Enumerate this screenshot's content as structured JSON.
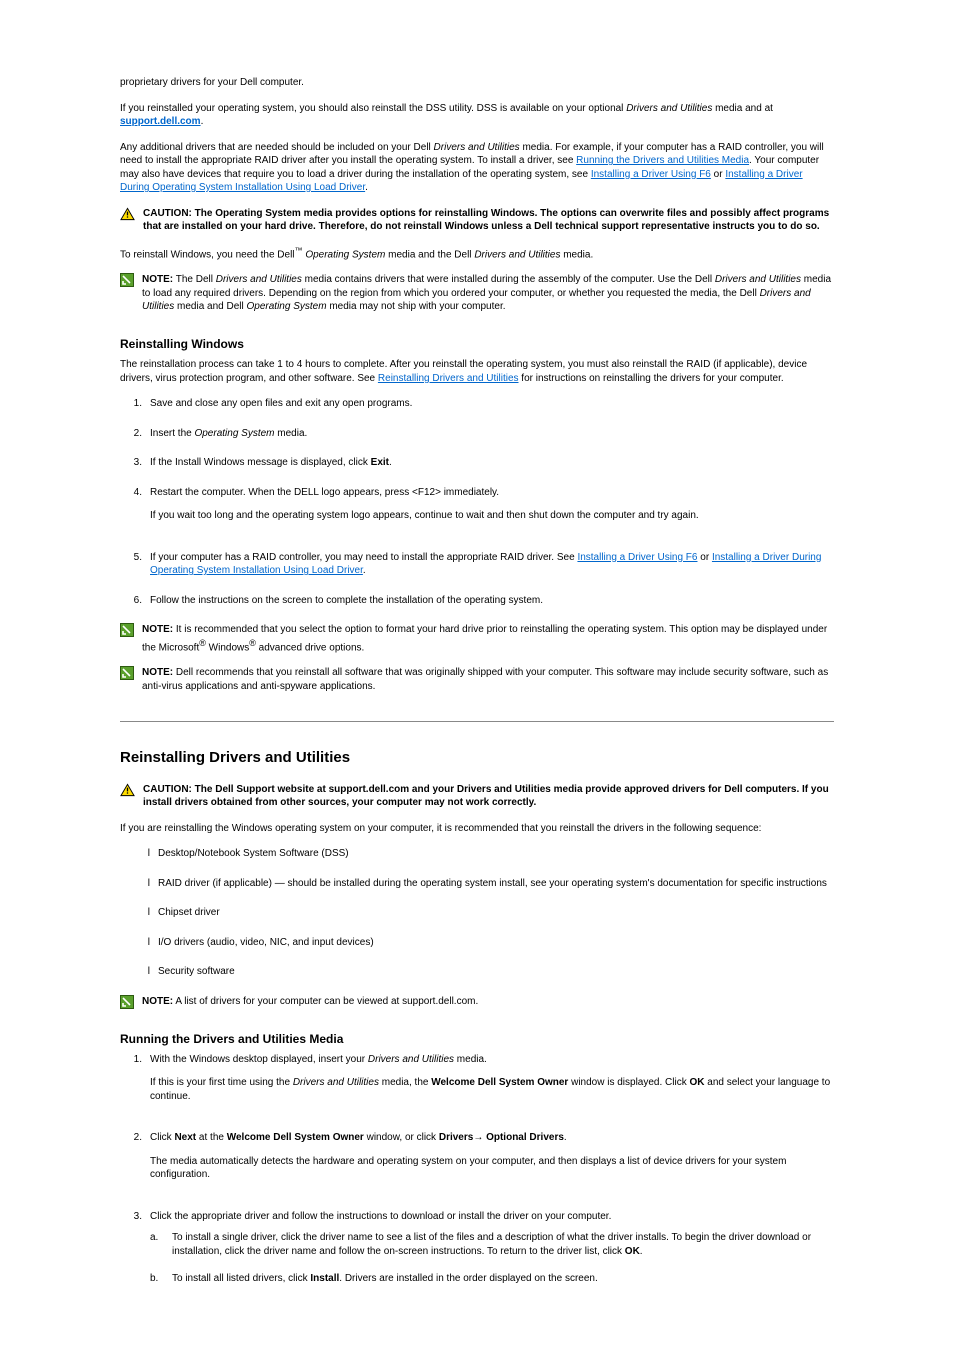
{
  "doc": {
    "intro_part1": "proprietary drivers for your Dell computer.",
    "intro_para2_plain": "If you reinstalled your operating system, you should also reinstall the DSS utility. DSS is available on your optional ",
    "intro_para2_italic": "Drivers and Utilities",
    "intro_para2_tail": " media and at ",
    "support_link": "support.dell.com",
    "period": ".",
    "para3_1": "Any additional drivers that are needed should be included on your Dell ",
    "para3_italic": "Drivers and Utilities",
    "para3_2": " media. For example, if your computer has a RAID controller, you will need to install the appropriate RAID driver after you install the operating system. To install a driver, see ",
    "link_running_du": "Running the Drivers and Utilities Media",
    "para3_3": ". Your computer may also have devices that require you to load a driver during the installation of the operating system, see ",
    "link_install_driver": "Installing a Driver Using F6",
    "text_or": " or ",
    "link_load_driver": "Installing a Driver During Operating System Installation Using Load Driver",
    "caution1_label": "CAUTION:",
    "caution1_body": " The Operating System media provides options for reinstalling Windows. The options can overwrite files and possibly affect programs that are installed on your hard drive. Therefore, do not reinstall Windows unless a Dell technical support representative instructs you to do so.",
    "reinstall_intro_prefix": "To reinstall Windows, you need the Dell",
    "tm": "™",
    "reinstall_intro_rest": " ",
    "os_media_italic": "Operating System",
    "reinstall_intro_tail": " media and the Dell ",
    "du_media_italic": "Drivers and Utilities",
    "reinstall_intro_end": " media.",
    "note1_label": "NOTE:",
    "note1_body_1": " The Dell ",
    "note1_body_3": " media contains drivers that were installed during the assembly of the computer. Use the Dell ",
    "note1_body_5": " media to load any required drivers. Depending on the region from which you ordered your computer, or whether you requested the media, the Dell ",
    "note1_body_6": " media and Dell ",
    "note1_body_8": " media may not ship with your computer.",
    "h3_reinstall": "Reinstalling Windows",
    "reinstall_p1_1": "The reinstallation process can take 1 to 4 hours to complete. After you reinstall the operating system, you must also reinstall the RAID (if applicable), device drivers, virus protection program, and other software. See ",
    "link_reinstall_drivers": "Reinstalling Drivers and Utilities",
    "reinstall_p1_2": " for instructions on reinstalling the drivers for your computer.",
    "step1_num": "1.",
    "step1": "Save and close any open files and exit any open programs.",
    "step2_num": "2.",
    "step2_1": "Insert the ",
    "step2_italic": "Operating System",
    "step2_2": " media.",
    "step3_num": "3.",
    "step3_1": "If the ",
    "step3_mono": "Install Windows",
    "step3_2": " message is displayed, click ",
    "step3_bold": "Exit",
    "step4_num": "4.",
    "step4_1": "Restart the computer. When the DELL logo appears, press ",
    "step4_key": "<F12>",
    "step4_2": " immediately.",
    "step4_extra": "If you wait too long and the operating system logo appears, continue to wait and then shut down the computer and try again.",
    "step5_num": "5.",
    "step5_1": "If your computer has a RAID controller, you may need to install the appropriate RAID driver. See ",
    "link_f6": "Installing a Driver Using F6",
    "step5_or": " or ",
    "link_loaddriver2": "Installing a Driver During Operating System Installation Using Load Driver",
    "step6_num": "6.",
    "step6_1": "Follow the instructions on the screen to complete the installation of the operating system.",
    "note2_label": "NOTE:",
    "note2_body_1": " It is recommended that you select the option to format your hard drive prior to reinstalling the operating system. This option may be displayed under the Microsoft",
    "reg": "®",
    "note2_body_2": " Windows",
    "note2_body_3": " advanced drive options.",
    "note3_label": "NOTE:",
    "note3_body": " Dell recommends that you reinstall all software that was originally shipped with your computer. This software may include security software, such as anti-virus applications and anti-spyware applications.",
    "h2_drivers": "Reinstalling Drivers and Utilities",
    "caution2_label": "CAUTION:",
    "caution2_body_1": " The Dell Support website at support.dell.com and your Drivers and Utilities media provide approved drivers for Dell computers. If you install drivers obtained from other sources, your computer may not work correctly.",
    "drv_p1_1": "If you are reinstalling the Windows operating system on your computer, it is recommended that you reinstall the drivers in the following sequence:",
    "drv_li1": "Desktop/Notebook System Software (DSS)",
    "drv_li2": "RAID driver (if applicable) — should be installed during the operating system install, see your operating system's documentation for specific instructions",
    "drv_li3": "Chipset driver",
    "drv_li4": "I/O drivers (audio, video, NIC, and input devices)",
    "drv_li5": "Security software",
    "note4_label": "NOTE:",
    "note4_body": " A list of drivers for your computer can be viewed at support.dell.com.",
    "h3_running": "Running the Drivers and Utilities Media",
    "rstep1_num": "1.",
    "rstep1_1": "With the Windows desktop displayed, insert your ",
    "rstep1_italic": "Drivers and Utilities",
    "rstep1_2": " media.",
    "rstep1_3a": "If this is your first time using the ",
    "rstep1_3b": " media, the ",
    "rstep1_bold1": "Welcome Dell System Owner",
    "rstep1_3c": " window is displayed. Click ",
    "rstep1_bold2": "OK",
    "rstep1_3d": " and select your language to continue.",
    "rstep2_num": "2.",
    "rstep2_1": "Click ",
    "rstep2_bold": "Next",
    "rstep2_2": " at the ",
    "rstep2_bold2": "Welcome Dell System Owner",
    "rstep2_3": " window, or click ",
    "rstep2_bold3": "Drivers",
    "arrow": "→",
    "rstep2_bold4": "Optional Drivers",
    "rstep2_4": ".",
    "rstep2_extra": "The media automatically detects the hardware and operating system on your computer, and then displays a list of device drivers for your system configuration.",
    "rstep3_num": "3.",
    "rstep3": "Click the appropriate driver and follow the instructions to download or install the driver on your computer.",
    "rstep3_a_label": "a.",
    "rstep3_a_1": "To install a single driver, click the driver name to see a list of the files and a description of what the driver installs. To begin the driver download or installation, click the driver name and follow the on-screen instructions. To return to the driver list, click ",
    "rstep3_a_bold": "OK",
    "rstep3_b_label": "b.",
    "rstep3_b_1": "To install all listed drivers, click ",
    "rstep3_b_bold": "Install",
    "rstep3_b_2": ". Drivers are installed in the order displayed on the screen."
  }
}
